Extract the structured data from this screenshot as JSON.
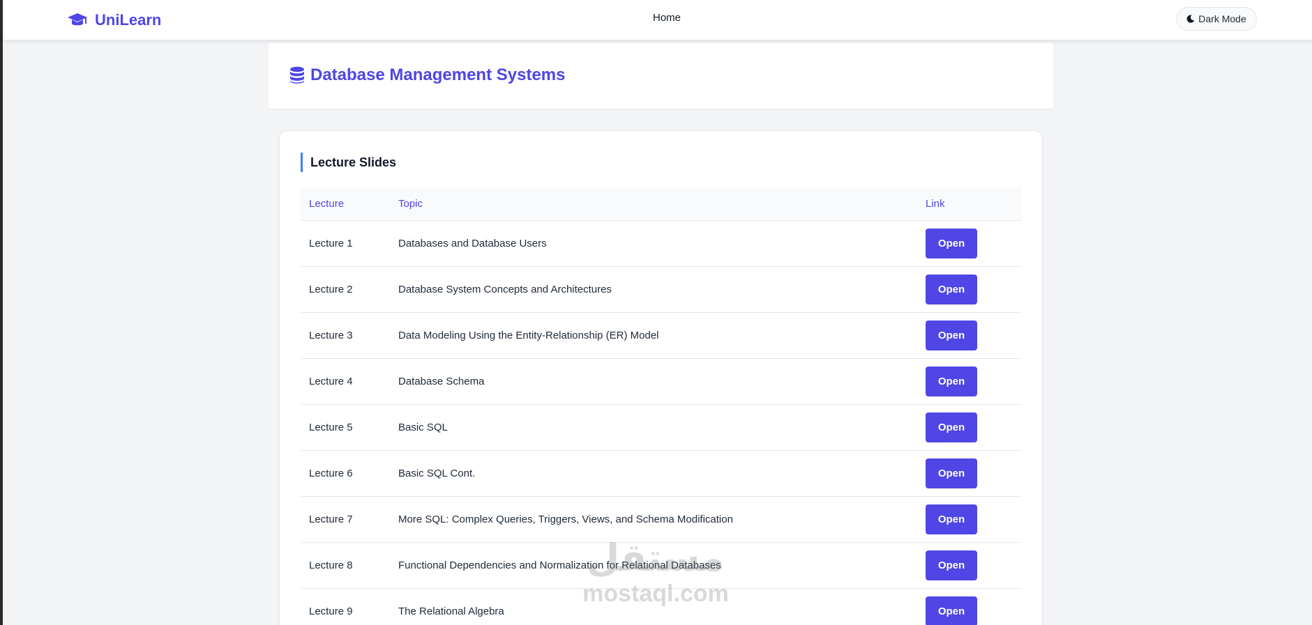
{
  "navbar": {
    "brand": "UniLearn",
    "home_label": "Home",
    "dark_mode_label": "Dark Mode"
  },
  "course": {
    "title": "Database Management Systems"
  },
  "section": {
    "title": "Lecture Slides",
    "columns": [
      "Lecture",
      "Topic",
      "Link"
    ],
    "open_label": "Open",
    "rows": [
      {
        "lecture": "Lecture 1",
        "topic": "Databases and Database Users"
      },
      {
        "lecture": "Lecture 2",
        "topic": "Database System Concepts and Architectures"
      },
      {
        "lecture": "Lecture 3",
        "topic": "Data Modeling Using the Entity-Relationship (ER) Model"
      },
      {
        "lecture": "Lecture 4",
        "topic": "Database Schema"
      },
      {
        "lecture": "Lecture 5",
        "topic": "Basic SQL"
      },
      {
        "lecture": "Lecture 6",
        "topic": "Basic SQL Cont."
      },
      {
        "lecture": "Lecture 7",
        "topic": "More SQL: Complex Queries, Triggers, Views, and Schema Modification"
      },
      {
        "lecture": "Lecture 8",
        "topic": "Functional Dependencies and Normalization for Relational Databases"
      },
      {
        "lecture": "Lecture 9",
        "topic": "The Relational Algebra"
      }
    ]
  },
  "watermark": {
    "arabic": "مستقل",
    "latin": "mostaql.com"
  },
  "colors": {
    "accent": "#4f46e5",
    "section_bar": "#3b82f6",
    "page_bg": "#f3f4f6"
  }
}
